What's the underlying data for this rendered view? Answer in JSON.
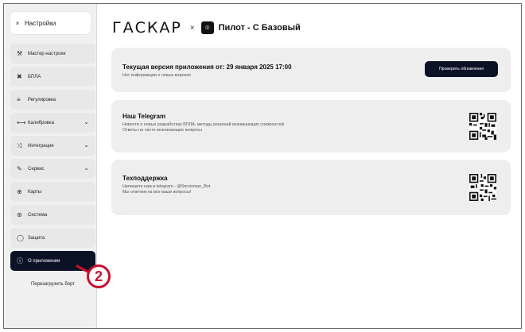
{
  "sidebar": {
    "header": {
      "close_glyph": "×",
      "title": "Настройки"
    },
    "items": [
      {
        "icon": "wizard-icon",
        "glyph": "⚒",
        "label": "Мастер настроек"
      },
      {
        "icon": "drone-icon",
        "glyph": "✖",
        "label": "БПЛА"
      },
      {
        "icon": "sliders-icon",
        "glyph": "≡",
        "label": "Регулировка"
      },
      {
        "icon": "calibration-icon",
        "glyph": "⟷",
        "label": "Калибровка",
        "chevron": "⌄"
      },
      {
        "icon": "integration-icon",
        "glyph": "⤨",
        "label": "Интеграция",
        "chevron": "⌄"
      },
      {
        "icon": "wrench-icon",
        "glyph": "✎",
        "label": "Сервис",
        "chevron": "⌄"
      },
      {
        "icon": "globe-icon",
        "glyph": "⊕",
        "label": "Карты"
      },
      {
        "icon": "system-icon",
        "glyph": "⊛",
        "label": "Система"
      },
      {
        "icon": "shield-icon",
        "glyph": "◯",
        "label": "Защита"
      },
      {
        "icon": "info-icon",
        "glyph": "ⓘ",
        "label": "О приложении",
        "active": true
      }
    ],
    "reboot_label": "Перезагрузить борт"
  },
  "header": {
    "logo_text": "ГАСКАР",
    "separator": "×",
    "drone_glyph": "⌾",
    "plan_title": "Пилот - С Базовый"
  },
  "cards": {
    "version": {
      "title": "Текущая версия приложения от: 29 января 2025 17:00",
      "subtitle": "Нет информации о новых версиях",
      "button_label": "Проверить обновления"
    },
    "telegram": {
      "title": "Наш Telegram",
      "line1": "Новости о новых разработках БПЛА, методы решений возникающих сложностей",
      "line2": "Ответы на часто возникающие вопросы"
    },
    "support": {
      "title": "Техподдержка",
      "line1": "Напишите нам в telegram - @Servisman_Bot",
      "line2": "Мы ответим на все ваши вопросы!"
    }
  },
  "annotation": {
    "number": "2",
    "color": "#c8102e"
  },
  "colors": {
    "accent_dark": "#0c1226",
    "card_bg": "#eeeeee",
    "sidebar_bg": "#f0f0f0"
  }
}
